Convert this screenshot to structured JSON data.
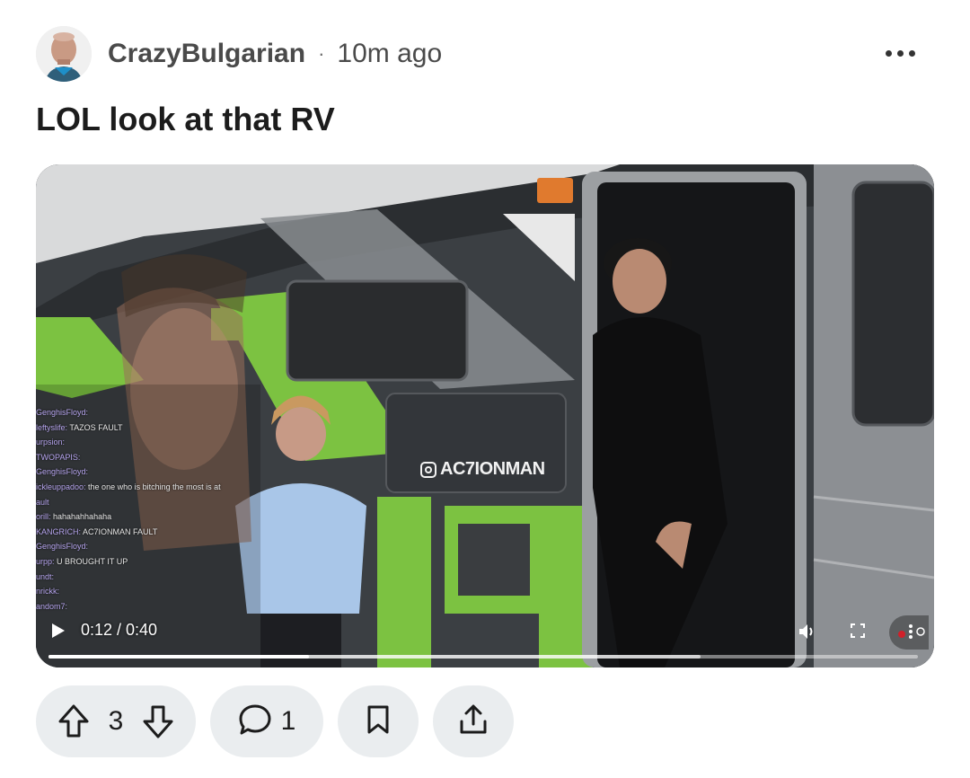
{
  "post": {
    "author": "CrazyBulgarian",
    "separator": "·",
    "time": "10m ago",
    "title": "LOL look at that RV"
  },
  "video": {
    "timecode": "0:12 / 0:40",
    "progress_fraction": 0.3,
    "buffered_fraction": 0.75,
    "watermark": "AC7IONMAN",
    "chat": [
      {
        "user": "GenghisFloyd:",
        "text": ""
      },
      {
        "user": "leftyslife:",
        "text": "TAZOS FAULT"
      },
      {
        "user": "urpsion:",
        "text": ""
      },
      {
        "user": "TWOPAPIS:",
        "text": ""
      },
      {
        "user": "GenghisFloyd:",
        "text": ""
      },
      {
        "user": "",
        "text": ""
      },
      {
        "user": "ickleuppadoo:",
        "text": "the one who is bitching the most is at"
      },
      {
        "user": "ault",
        "text": ""
      },
      {
        "user": "orill:",
        "text": "hahahahhahaha"
      },
      {
        "user": "KANGRICH:",
        "text": "AC7IONMAN FAULT"
      },
      {
        "user": "GenghisFloyd:",
        "text": ""
      },
      {
        "user": "urpp:",
        "text": "U BROUGHT IT UP"
      },
      {
        "user": "undt:",
        "text": ""
      },
      {
        "user": "nrickk:",
        "text": ""
      },
      {
        "user": "andom7:",
        "text": ""
      }
    ]
  },
  "actions": {
    "upvotes": "3",
    "comments": "1"
  },
  "icons": {
    "more": "more-options-icon",
    "upvote": "arrow-up-icon",
    "downvote": "arrow-down-icon",
    "comment": "comment-bubble-icon",
    "save": "bookmark-icon",
    "share": "share-icon"
  },
  "colors": {
    "pill_bg": "#eaedef",
    "rv_green": "#7cc241"
  }
}
